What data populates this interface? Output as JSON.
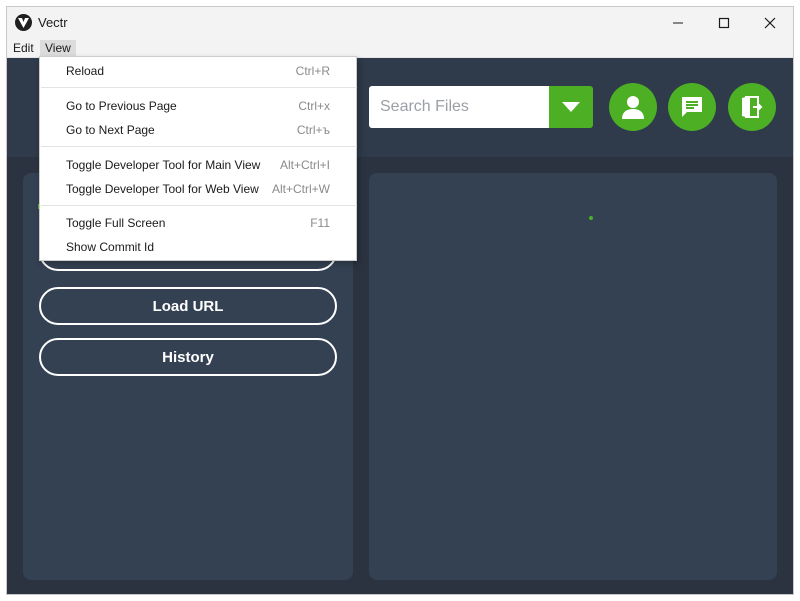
{
  "window": {
    "title": "Vectr",
    "controls": {
      "minimize": "minimize-icon",
      "maximize": "maximize-icon",
      "close": "close-icon"
    }
  },
  "menubar": {
    "items": [
      {
        "label": "Edit"
      },
      {
        "label": "View"
      }
    ]
  },
  "view_menu": {
    "items": [
      {
        "label": "Reload",
        "accelerator": "Ctrl+R"
      },
      {
        "label": "Go to Previous Page",
        "accelerator": "Ctrl+x"
      },
      {
        "label": "Go to Next Page",
        "accelerator": "Ctrl+ъ"
      },
      {
        "label": "Toggle Developer Tool for Main View",
        "accelerator": "Alt+Ctrl+I"
      },
      {
        "label": "Toggle Developer Tool for Web View",
        "accelerator": "Alt+Ctrl+W"
      },
      {
        "label": "Toggle Full Screen",
        "accelerator": "F11"
      },
      {
        "label": "Show Commit Id",
        "accelerator": ""
      }
    ]
  },
  "header": {
    "search": {
      "placeholder": "Search Files"
    },
    "buttons": [
      "account-icon",
      "chat-icon",
      "logout-icon"
    ]
  },
  "sidebar": {
    "buttons": [
      {
        "label": "Load URL"
      },
      {
        "label": "History"
      }
    ]
  },
  "colors": {
    "accent": "#4caf24",
    "header_bg": "#2f3a4a",
    "panel_bg": "#344152",
    "body_bg": "#2b3340"
  }
}
